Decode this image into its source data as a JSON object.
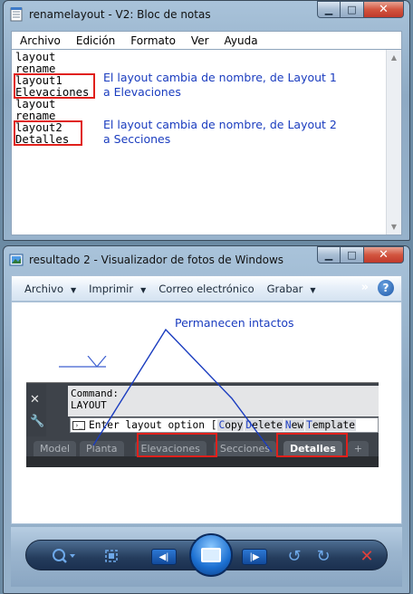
{
  "notepad": {
    "title": "renamelayout - V2: Bloc de notas",
    "menu": [
      "Archivo",
      "Edición",
      "Formato",
      "Ver",
      "Ayuda"
    ],
    "lines": [
      "layout",
      "rename",
      "layout1",
      "Elevaciones",
      "layout",
      "rename",
      "layout2",
      "Detalles"
    ],
    "note1_line1": "El layout cambia de nombre, de Layout 1",
    "note1_line2": "a Elevaciones",
    "note2_line1": "El layout cambia de nombre, de Layout 2",
    "note2_line2": "a Secciones"
  },
  "viewer": {
    "title": "resultado 2 - Visualizador de fotos de Windows",
    "toolbar": {
      "archivo": "Archivo",
      "imprimir": "Imprimir",
      "correo": "Correo electrónico",
      "grabar": "Grabar",
      "help": "?"
    },
    "annotation": "Permanecen intactos",
    "cad": {
      "cmd_line1": "Command:",
      "cmd_line2": "LAYOUT",
      "input_prefix": "Enter layout option [",
      "options": [
        {
          "key": "C",
          "rest": "opy"
        },
        {
          "key": "D",
          "rest": "elete"
        },
        {
          "key": "N",
          "rest": "ew"
        },
        {
          "key": "T",
          "rest": "emplate"
        }
      ],
      "tabs": [
        "Model",
        "Planta",
        "Elevaciones",
        "Secciones",
        "Detalles",
        "+"
      ],
      "active_tab": "Detalles"
    }
  },
  "colors": {
    "annotation_blue": "#1a3cbf",
    "highlight_red": "#e0201b"
  }
}
